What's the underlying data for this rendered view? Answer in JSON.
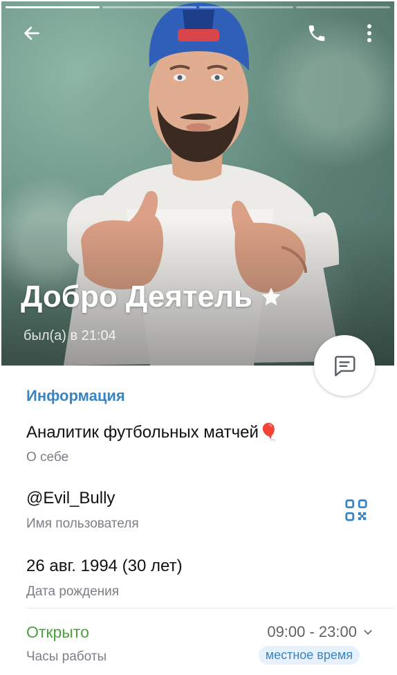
{
  "profile": {
    "name": "Добро Деятель",
    "last_seen": "был(а) в 21:04"
  },
  "info": {
    "section_title": "Информация",
    "bio": "Аналитик футбольных матчей🎈",
    "bio_label": "О себе",
    "username": "@Evil_Bully",
    "username_label": "Имя пользователя",
    "birthday": "26 авг. 1994 (30 лет)",
    "birthday_label": "Дата рождения",
    "status": "Открыто",
    "hours": "09:00 - 23:00",
    "hours_label": "Часы работы",
    "timezone_badge": "местное время"
  },
  "icons": {
    "back": "arrow-left-icon",
    "call": "phone-icon",
    "more": "more-vertical-icon",
    "premium": "star-icon",
    "message": "chat-bubble-icon",
    "qr": "qr-code-icon",
    "expand": "chevron-down-icon"
  },
  "colors": {
    "accent": "#3a84c2",
    "open_status": "#4aa13b",
    "secondary_text": "#7b7f84"
  }
}
